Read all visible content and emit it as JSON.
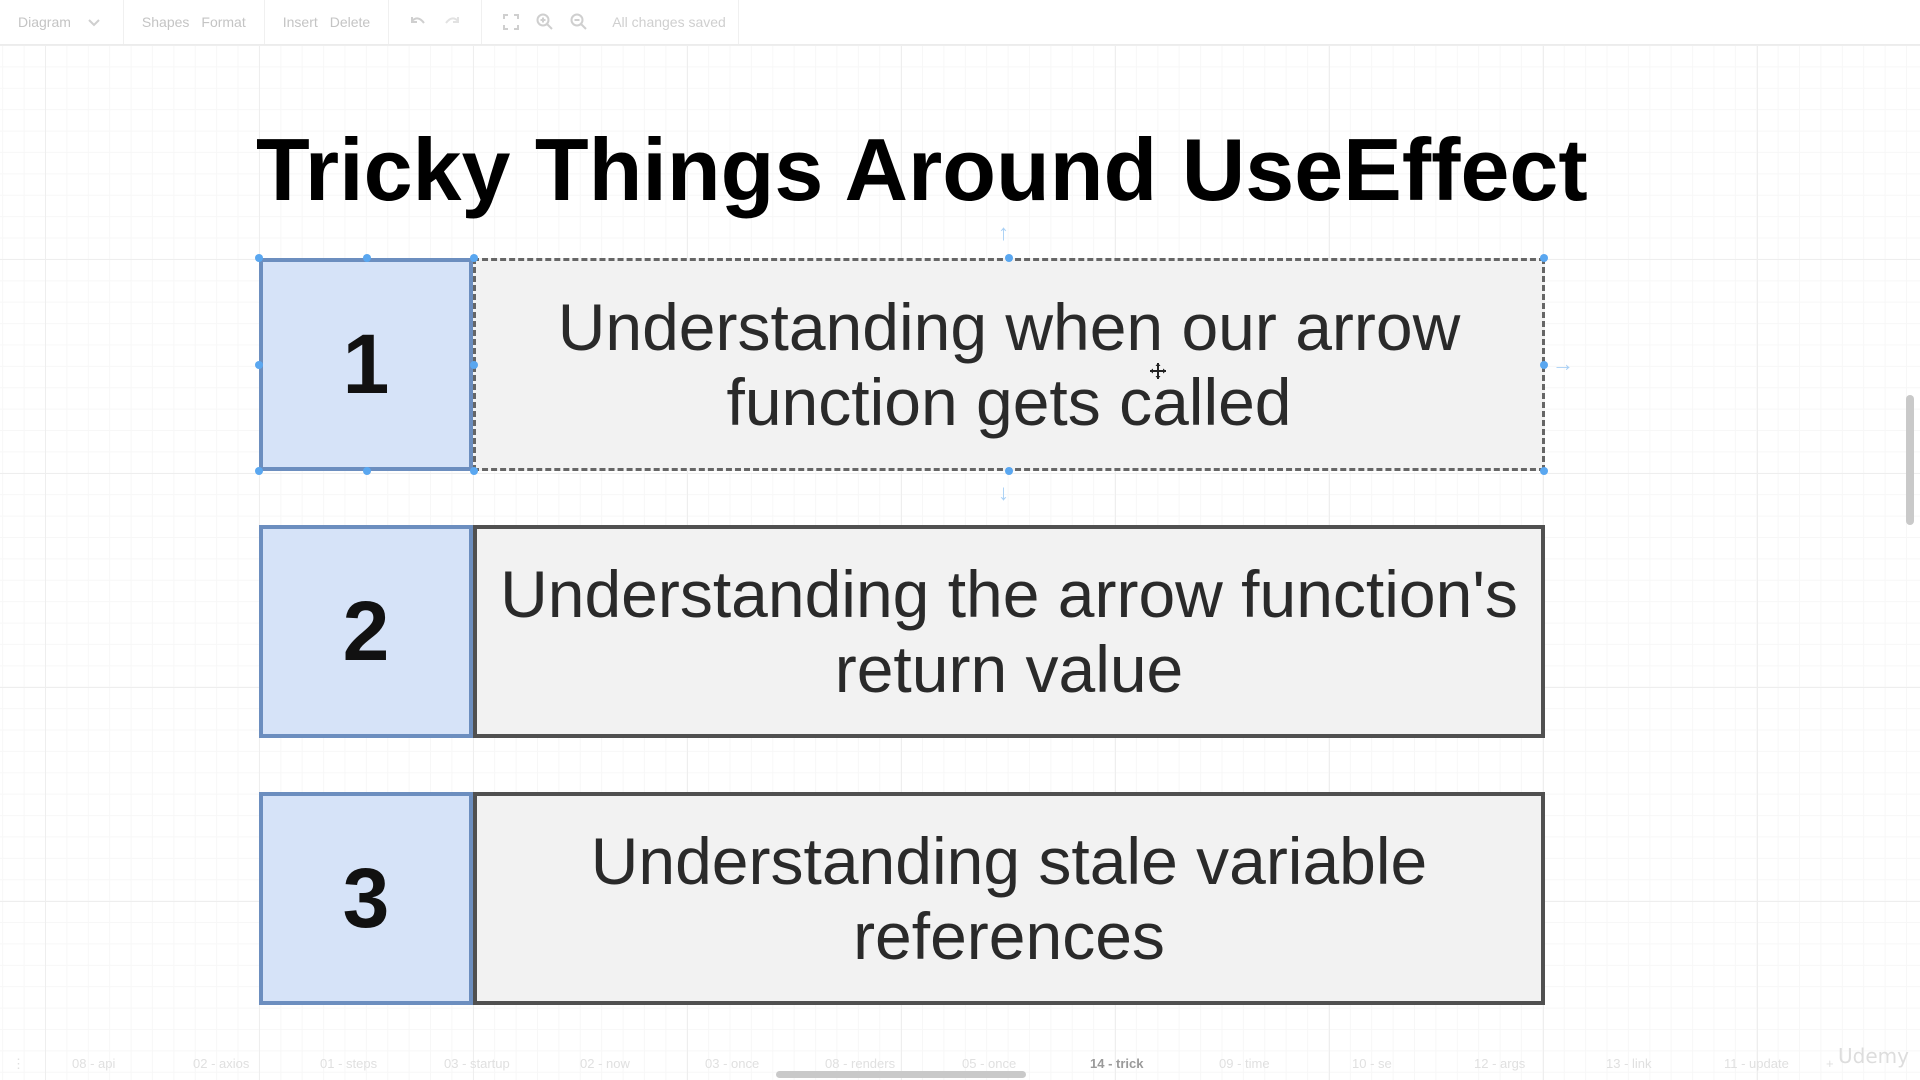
{
  "toolbar": {
    "diagram_menu": "Diagram",
    "shapes_label": "Shapes",
    "format_label": "Format",
    "insert_label": "Insert",
    "delete_label": "Delete",
    "status_text": "All changes saved"
  },
  "slide": {
    "title": "Tricky Things Around UseEffect",
    "items": [
      {
        "number": "1",
        "text": "Understanding when our arrow function gets called"
      },
      {
        "number": "2",
        "text": "Understanding the arrow function's return value"
      },
      {
        "number": "3",
        "text": "Understanding stale variable references"
      }
    ]
  },
  "page_tabs": [
    "08 - api",
    "02 - axios",
    "01 - steps",
    "03 - startup",
    "02 - now",
    "03 - once",
    "08 - renders",
    "05 - once",
    "14 - trick",
    "09 - time",
    "10 - se",
    "12 - args",
    "13 - link",
    "11 - update"
  ],
  "active_page_tab": "14 - trick",
  "brand": "Udemy",
  "colors": {
    "number_box_fill": "#d6e3f8",
    "number_box_border": "#6c8ebf",
    "text_box_fill": "#f2f2f2",
    "text_box_border": "#505050",
    "selection_handle": "#5aa7f0"
  }
}
